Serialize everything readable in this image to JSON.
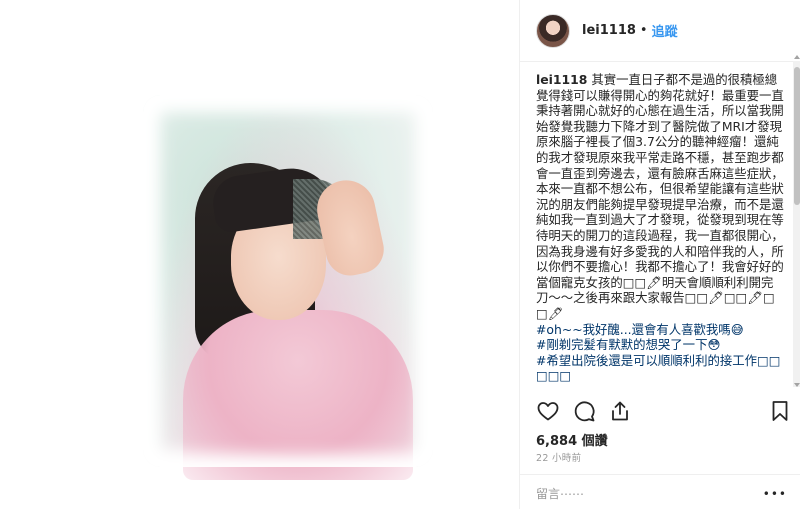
{
  "post": {
    "username": "lei1118",
    "separator": "•",
    "follow_label": "追蹤"
  },
  "caption": {
    "author": "lei1118",
    "body": "其實一直日子都不是過的很積極總覺得錢可以賺得開心的夠花就好！最重要一直秉持著開心就好的心態在過生活，所以當我開始發覺我聽力下降才到了醫院做了MRI才發現原來腦子裡長了個3.7公分的聽神經瘤！還純的我才發現原來我平常走路不穩，甚至跑步都會一直歪到旁邊去，還有臉麻舌麻這些症狀，本來一直都不想公布，但很希望能讓有這些狀況的朋友們能夠提早發現提早治療，而不是還純如我一直到過大了才發現，從發現到現在等待明天的開刀的這段過程，我一直都很開心，因為我身邊有好多愛我的人和陪伴我的人，所以你們不要擔心！我都不擔心了！我會好好的當個寵克女孩的□□🖊明天會順順利利開完刀～～之後再來跟大家報告□□🖊□□🖊□□🖊",
    "hashtags": [
      "#oh~~我好醜...還會有人喜歡我嗎😅",
      "#剛剃完髮有默默的想哭了一下😳",
      "#希望出院後還是可以順順利利的接工作□□□□□"
    ]
  },
  "stats": {
    "likes": "6,884 個讚",
    "time": "22 小時前"
  },
  "comment": {
    "placeholder": "留言⋯⋯"
  },
  "icons": {
    "like": "heart-icon",
    "comment": "comment-icon",
    "share": "share-icon",
    "save": "bookmark-icon",
    "more": "more-icon"
  }
}
